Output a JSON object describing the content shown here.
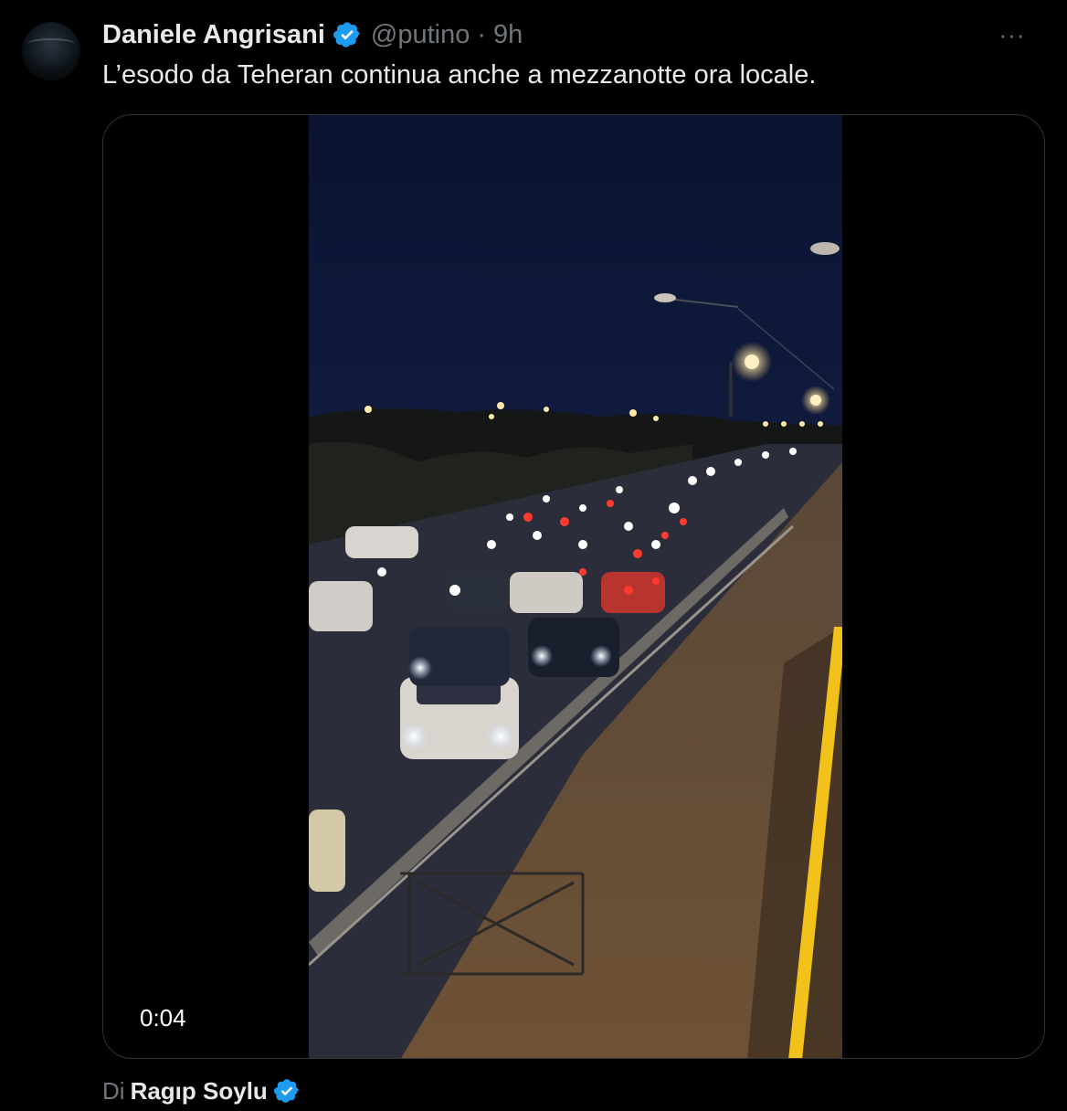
{
  "post": {
    "author_name": "Daniele Angrisani",
    "handle": "@putino",
    "separator": "·",
    "time_ago": "9h",
    "more_label": "···",
    "text": "L’esodo da Teheran continua anche a mezzanotte ora locale."
  },
  "media": {
    "type": "video",
    "time_display": "0:04"
  },
  "source": {
    "prefix": "Di",
    "name": "Ragıp Soylu"
  },
  "icons": {
    "verified": "verified-badge-icon",
    "more": "more-options-icon"
  },
  "colors": {
    "background": "#000000",
    "primary_text": "#e7e9ea",
    "secondary_text": "#71767b",
    "verified_blue": "#1d9bf0",
    "border": "#2f3336"
  }
}
